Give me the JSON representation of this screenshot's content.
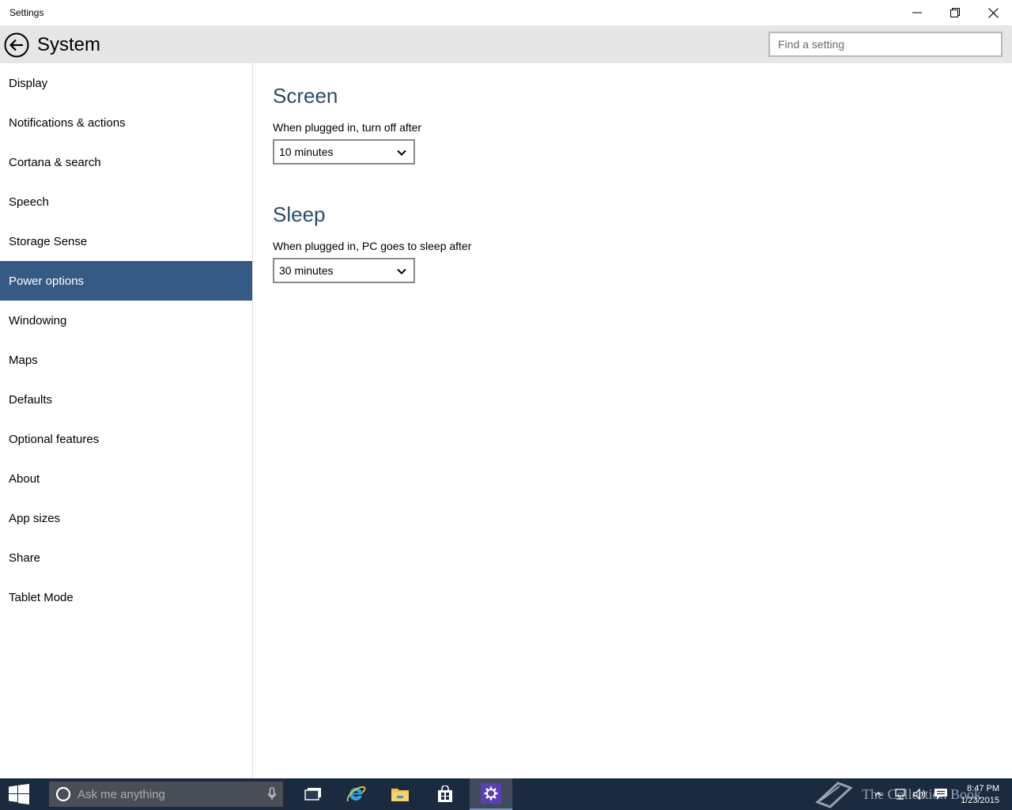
{
  "window": {
    "title": "Settings"
  },
  "header": {
    "title": "System",
    "search_placeholder": "Find a setting"
  },
  "sidebar": {
    "items": [
      {
        "label": "Display"
      },
      {
        "label": "Notifications & actions"
      },
      {
        "label": "Cortana & search"
      },
      {
        "label": "Speech"
      },
      {
        "label": "Storage Sense"
      },
      {
        "label": "Power options"
      },
      {
        "label": "Windowing"
      },
      {
        "label": "Maps"
      },
      {
        "label": "Defaults"
      },
      {
        "label": "Optional features"
      },
      {
        "label": "About"
      },
      {
        "label": "App sizes"
      },
      {
        "label": "Share"
      },
      {
        "label": "Tablet Mode"
      }
    ],
    "active_index": 5
  },
  "main": {
    "screen": {
      "title": "Screen",
      "label": "When plugged in, turn off after",
      "value": "10 minutes"
    },
    "sleep": {
      "title": "Sleep",
      "label": "When plugged in, PC goes to sleep after",
      "value": "30 minutes"
    }
  },
  "taskbar": {
    "search_placeholder": "Ask me anything",
    "watermark": "The Collection Book",
    "time": "8:47 PM",
    "date": "1/23/2015"
  },
  "colors": {
    "accent": "#355a83",
    "section_title": "#2b4a6b",
    "taskbar": "#1b2a3f"
  }
}
